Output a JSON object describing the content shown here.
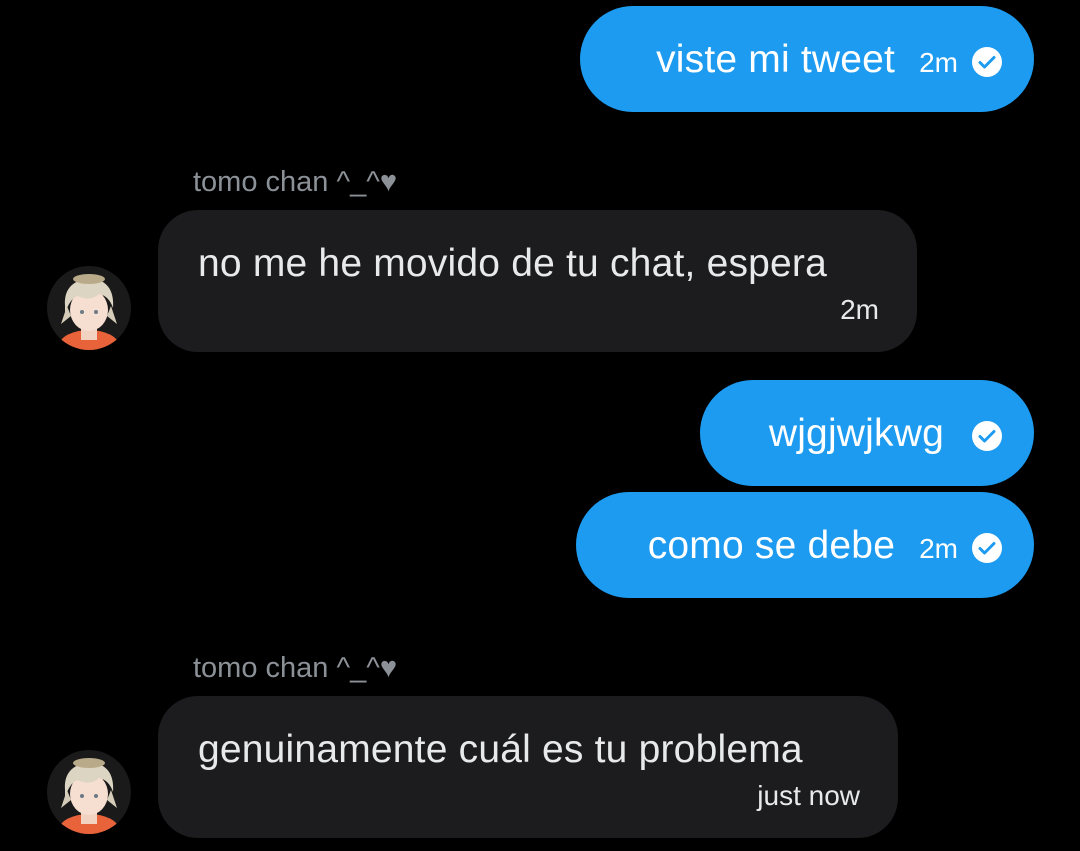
{
  "messages": [
    {
      "direction": "outgoing",
      "text": "viste mi tweet",
      "time": "2m",
      "status_icon": "check-circle-icon"
    },
    {
      "direction": "incoming",
      "sender": "tomo chan ^_^♥",
      "text": "no me he movido de tu chat, espera",
      "time": "2m"
    },
    {
      "direction": "outgoing",
      "text": "wjgjwjkwg",
      "status_icon": "check-circle-icon"
    },
    {
      "direction": "outgoing",
      "text": "como se debe",
      "time": "2m",
      "status_icon": "check-circle-icon"
    },
    {
      "direction": "incoming",
      "sender": "tomo chan ^_^♥",
      "text": "genuinamente cuál es tu problema",
      "time": "just now"
    }
  ],
  "colors": {
    "background": "#000000",
    "outgoing_bubble": "#1d9bf0",
    "incoming_bubble": "#1c1c1e",
    "sender_name": "#8b9197",
    "text": "#e7e9ea"
  }
}
